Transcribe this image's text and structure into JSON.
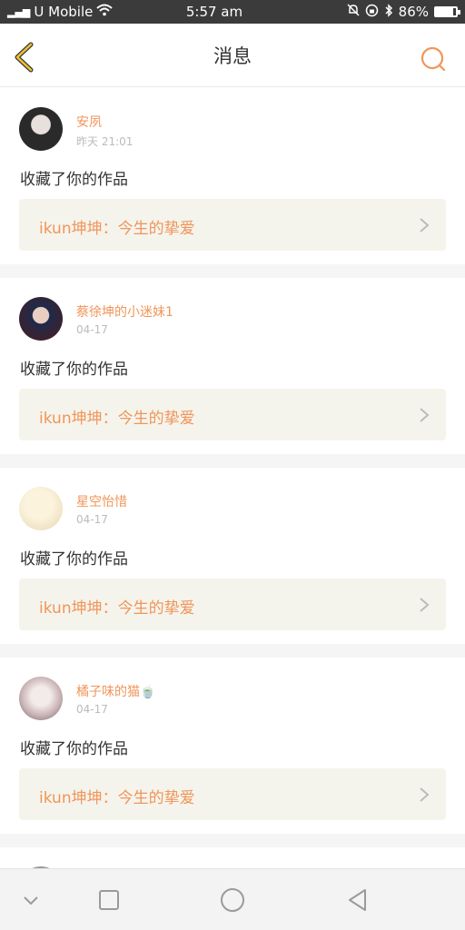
{
  "status_bar": {
    "carrier": "U Mobile",
    "time": "5:57 am",
    "battery": "86%",
    "battery_level": 0.86
  },
  "header": {
    "title": "消息",
    "back_icon": "chevron-left-icon",
    "search_icon": "search-icon",
    "accent_color": "#f0955a"
  },
  "messages": [
    {
      "username": "安夙",
      "time": "昨天 21:01",
      "action": "收藏了你的作品",
      "work_title": "ikun坤坤：今生的挚爱"
    },
    {
      "username": "蔡徐坤的小迷妹1",
      "time": "04-17",
      "action": "收藏了你的作品",
      "work_title": "ikun坤坤：今生的挚爱"
    },
    {
      "username": "星空怡惜",
      "time": "04-17",
      "action": "收藏了你的作品",
      "work_title": "ikun坤坤：今生的挚爱"
    },
    {
      "username": "橘子味的猫🍵",
      "time": "04-17",
      "action": "收藏了你的作品",
      "work_title": "ikun坤坤：今生的挚爱"
    }
  ],
  "nav": {
    "icons": [
      "chevron-down-icon",
      "square-icon",
      "circle-icon",
      "triangle-back-icon"
    ]
  }
}
